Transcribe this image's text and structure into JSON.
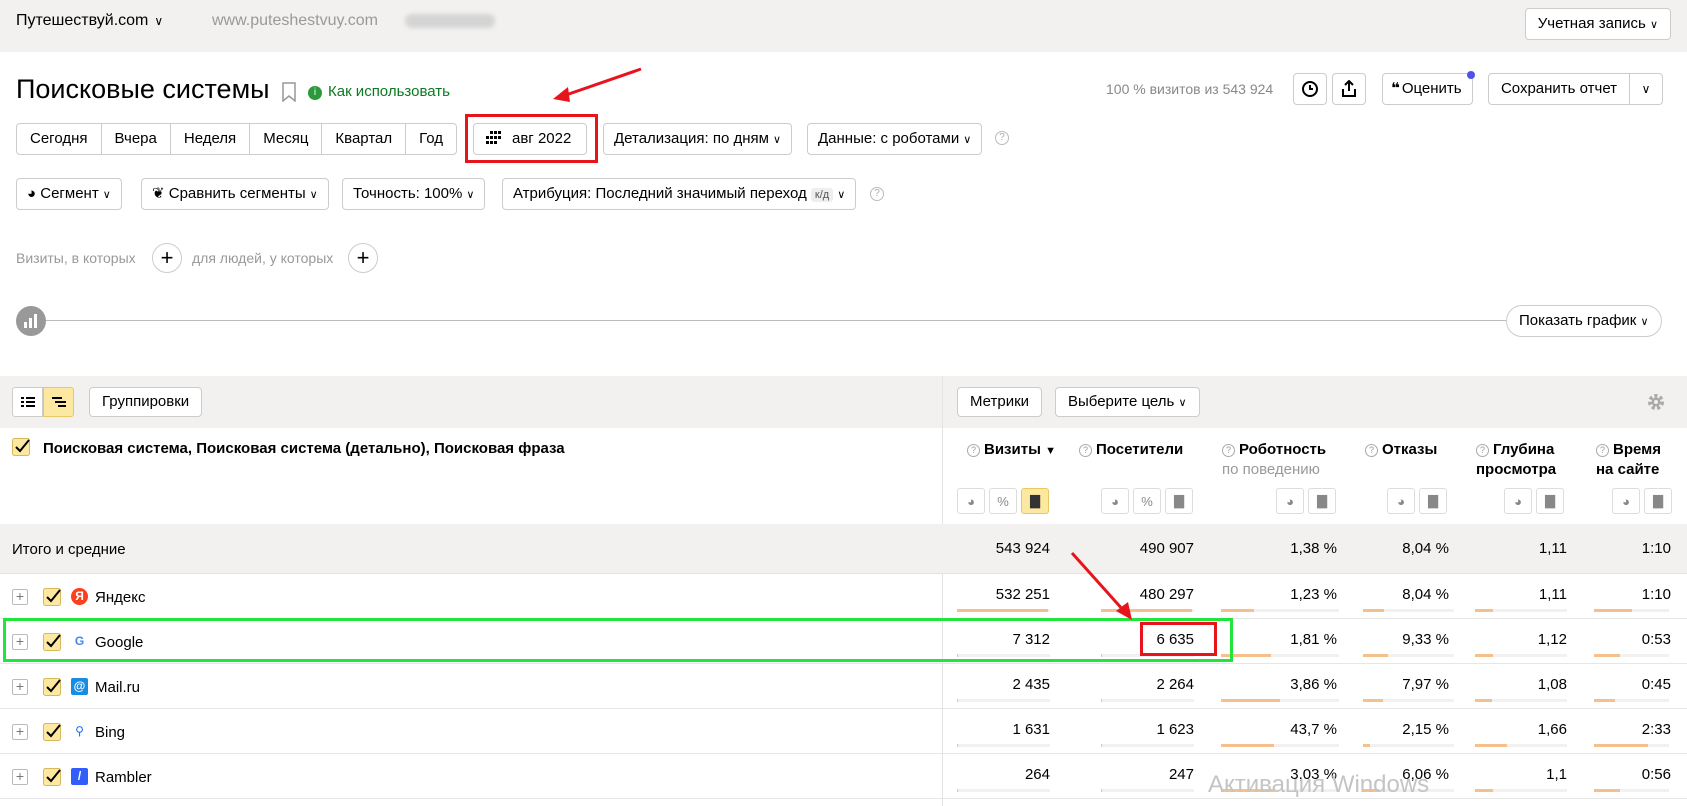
{
  "topbar": {
    "site_name": "Путешествуй.com",
    "site_url": "www.puteshestvuy.com",
    "account_label": "Учетная запись"
  },
  "header": {
    "title": "Поисковые системы",
    "how_to_use": "Как использовать",
    "visits_summary": "100 % визитов из 543 924",
    "rate_label": "Оценить",
    "save_report_label": "Сохранить отчет"
  },
  "periods": [
    "Сегодня",
    "Вчера",
    "Неделя",
    "Месяц",
    "Квартал",
    "Год"
  ],
  "date_range": "авг 2022",
  "detail_label": "Детализация: по дням",
  "data_label": "Данные: с роботами",
  "segment_label": "Сегмент",
  "compare_label": "Сравнить сегменты",
  "accuracy_label": "Точность: 100%",
  "attribution": {
    "label": "Атрибуция: Последний значимый переход",
    "badge": "к/д"
  },
  "filters": {
    "visits_where": "Визиты, в которых",
    "people_where": "для людей, у которых"
  },
  "show_graph_label": "Показать график",
  "toolbar": {
    "groupings_label": "Группировки",
    "metrics_label": "Метрики",
    "goal_label": "Выберите цель"
  },
  "table": {
    "dimensions_title": "Поисковая система, Поисковая система (детально), Поисковая фраза",
    "columns": [
      {
        "title": "Визиты",
        "sort": "▼"
      },
      {
        "title": "Посетители"
      },
      {
        "title": "Роботность",
        "subtitle": "по поведению"
      },
      {
        "title": "Отказы"
      },
      {
        "title": "Глубина просмотра"
      },
      {
        "title": "Время на сайте"
      }
    ],
    "totals": {
      "label": "Итого и средние",
      "values": [
        "543 924",
        "490 907",
        "1,38 %",
        "8,04 %",
        "1,11",
        "1:10"
      ]
    },
    "rows": [
      {
        "name": "Яндекс",
        "icon": "yandex-icon",
        "values": [
          "532 251",
          "480 297",
          "1,23 %",
          "8,04 %",
          "1,11",
          "1:10"
        ],
        "bars": [
          0.98,
          0.98,
          0.28,
          0.23,
          0.2,
          0.5
        ]
      },
      {
        "name": "Google",
        "icon": "google-icon",
        "values": [
          "7 312",
          "6 635",
          "1,81 %",
          "9,33 %",
          "1,12",
          "0:53"
        ],
        "bars": [
          0.01,
          0.01,
          0.42,
          0.27,
          0.2,
          0.35
        ]
      },
      {
        "name": "Mail.ru",
        "icon": "mailru-icon",
        "values": [
          "2 435",
          "2 264",
          "3,86 %",
          "7,97 %",
          "1,08",
          "0:45"
        ],
        "bars": [
          0.01,
          0.01,
          0.5,
          0.22,
          0.19,
          0.28
        ]
      },
      {
        "name": "Bing",
        "icon": "bing-icon",
        "values": [
          "1 631",
          "1 623",
          "43,7 %",
          "2,15 %",
          "1,66",
          "2:33"
        ],
        "bars": [
          0.01,
          0.01,
          0.45,
          0.08,
          0.35,
          0.72
        ]
      },
      {
        "name": "Rambler",
        "icon": "rambler-icon",
        "values": [
          "264",
          "247",
          "3,03 %",
          "6,06 %",
          "1,1",
          "0:56"
        ],
        "bars": [
          0.01,
          0.01,
          0.45,
          0.18,
          0.2,
          0.35
        ]
      }
    ]
  },
  "watermark": "Активация Windows",
  "colors": {
    "accent_yellow": "#fde8a2",
    "highlight_red": "#e8141c",
    "highlight_green": "#21e53a",
    "bar": "#f5c08b",
    "link_green": "#0b7a22"
  }
}
